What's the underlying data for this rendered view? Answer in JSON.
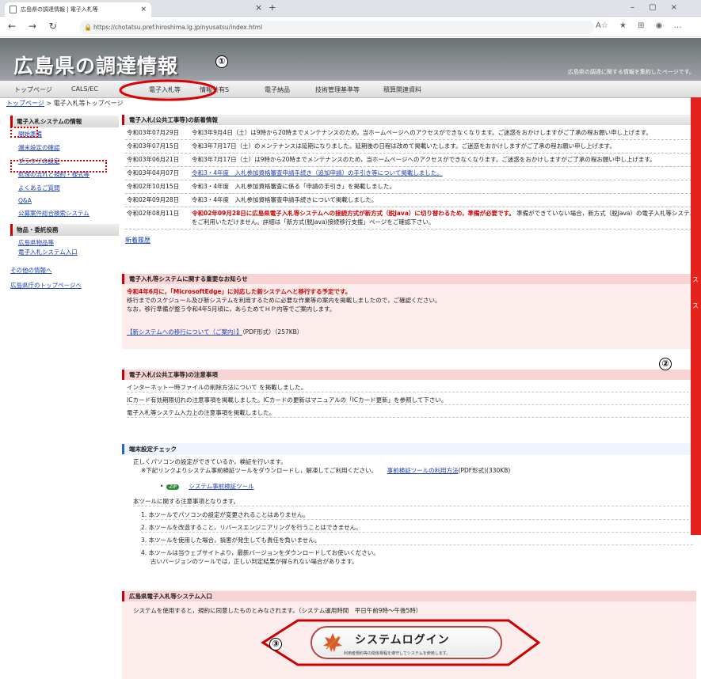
{
  "browser": {
    "tab_title": "広島県の調達情報 | 電子入札等",
    "url": "https://chotatsu.pref.hiroshima.lg.jp/nyusatsu/index.html",
    "close": "×"
  },
  "site": {
    "title": "広島県の調達情報",
    "tagline": "広島県の調達に関する情報を集約したページです。"
  },
  "gnav": [
    "トップページ",
    "CALS/EC",
    "電子入札等",
    "情報共有S",
    "電子納品",
    "技術管理基準等",
    "積算関連資料"
  ],
  "breadcrumb": {
    "home": "トップページ",
    "sep": " > ",
    "current": "電子入札等トップページ"
  },
  "sidebar": {
    "head1": "電子入札システムの情報",
    "links1": [
      "開始準備",
      "端末設定の確認",
      "ブラウザの設定",
      "処理の流れと規約・様式等",
      "よくあるご質問",
      "Q&A",
      "公募案件総合検索システム"
    ],
    "head2": "物品・委託役務",
    "links2": [
      "広島県物品等",
      "電子入札システム入口"
    ],
    "other": [
      "その他の情報へ",
      "広島県庁のトップページへ"
    ]
  },
  "news": {
    "heading": "電子入札(公共工事等)の新着情報",
    "rows": [
      {
        "date": "令和03年07月29日",
        "text": "令和3年9月4日（土）は9時から20時までメンテナンスのため，当ホームページへのアクセスができなくなります。ご迷惑をおかけしますがご了承の程お願い申し上げます。"
      },
      {
        "date": "令和03年07月15日",
        "text": "令和3年7月17日（土）のメンテナンスは延期になりました。延期後の日程は改めて掲載いたします。ご迷惑をおかけしますがご了承の程お願い申し上げます。"
      },
      {
        "date": "令和03年06月21日",
        "text": "令和3年7月17日（土）は9時から20時までメンテナンスのため，当ホームページへのアクセスができなくなります。ご迷惑をおかけしますがご了承の程お願い申し上げます。"
      },
      {
        "date": "令和03年04月07日",
        "text": "令和3・4年度　入札参加資格審査申請手続き（追加申請）の手引き等について掲載しました。"
      },
      {
        "date": "令和02年10月15日",
        "text": "令和3・4年度　入札参加資格審査に係る「申請の手引き」を掲載しました。"
      },
      {
        "date": "令和02年09月28日",
        "text": "令和3・4年度　入札参加資格審査申請手続きについて掲載しました。"
      },
      {
        "date": "令和02年08月11日",
        "red": "令和02年09月28日に広島県電子入札等システムへの接続方式が新方式（脱Java）に切り替わるため，準備が必要です。",
        "text": "準備ができていない場合，新方式（脱Java）の電子入札等システムをご利用いただけません。詳細は「新方式(脱Java)接続移行支援」ページをご確認下さい。"
      }
    ],
    "history": "新着履歴"
  },
  "important": {
    "heading": "電子入札等システムに関する重要なお知らせ",
    "red": "令和4年6月に，「MicrosoftEdge」に対応した新システムへと移行する予定です。",
    "line2": "移行までのスケジュール及び新システムを利用するために必要な作業等の案内を掲載しましたので，ご確認ください。",
    "line3": "なお，移行準備が整う令和4年5月頃に，あらためてＨＰ内等でご案内します。",
    "link": "【新システムへの移行について（ご案内）】",
    "link_suffix": "（PDF形式）（257KB）"
  },
  "caution": {
    "heading": "電子入札(公共工事等)の注意事項",
    "items": [
      "インターネット一時ファイルの削除方法について を掲載しました。",
      "ICカード有効期限切れの注意事項を掲載しました。ICカードの更新はマニュアルの「ICカード更新」を参照して下さい。",
      "電子入札等システム入力上の注意事項を掲載しました。"
    ]
  },
  "terminal": {
    "heading": "端末設定チェック",
    "line1": "正しくパソコンの設定ができているか，検証を行います。",
    "line2": "※下記リンクよりシステム事前検証ツールをダウンロードし，解凍してご利用ください。",
    "howto_link": "事前検証ツールの利用方法",
    "howto_suffix": "(PDF形式)(330KB)",
    "zip_badge": "ZIP",
    "tool_link": "システム事前検証ツール",
    "notes_head": "本ツールに関する注意事項となります。",
    "notes": [
      "1. 本ツールでパソコンの設定が変更されることはありません。",
      "2. 本ツールを改造すること，リバースエンジニアリングを行うことはできません。",
      "3. 本ツールを使用した場合，損害が発生しても責任を負いません。",
      "4. 本ツールは当ウェブサイトより，最新バージョンをダウンロードしてお使いください。",
      "古いバージョンのツールでは，正しい判定結果が得られない場合があります。"
    ]
  },
  "entry": {
    "heading": "広島県電子入札等システム入口",
    "text": "システムを使用すると，規約に同意したものとみなされます。（システム運用時間　平日午前9時～午後5時）",
    "login_label": "システムログイン",
    "login_sub": "利用者規約等の関係規程を遵守してシステムを使用します。"
  },
  "callouts": [
    "①",
    "②",
    "③"
  ],
  "colors": {
    "accent_red": "#e4231f",
    "link": "#1a3fb0"
  }
}
